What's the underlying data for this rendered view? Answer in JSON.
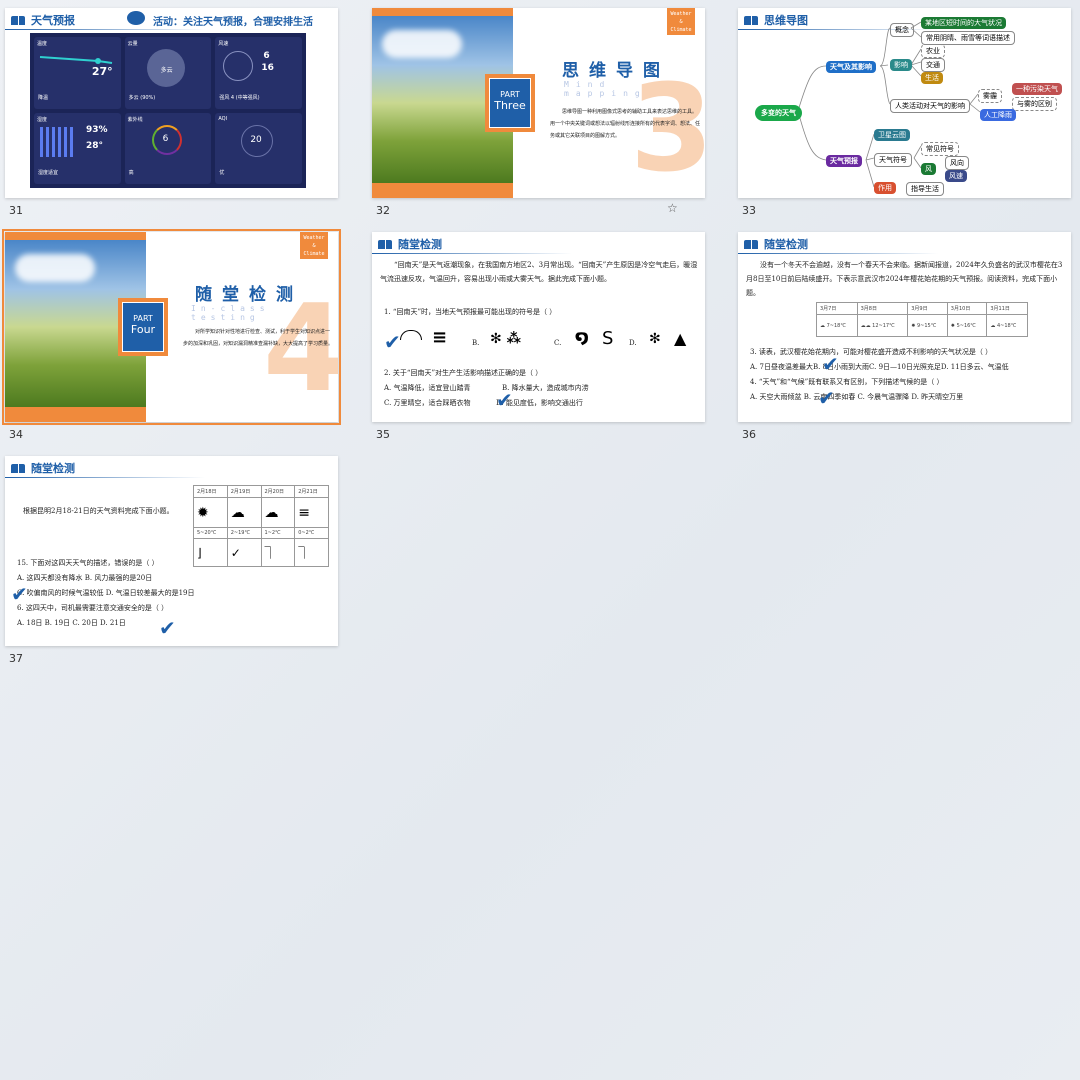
{
  "slides": [
    {
      "number": "31",
      "header": "天气预报",
      "activity": "活动：关注天气预报，合理安排生活",
      "dashboard": {
        "temp": "27°",
        "humidity": "93%",
        "feels": "28°",
        "uv": "6",
        "aqi": "20",
        "wind_level": "6",
        "wind_speed": "16",
        "cloud": "多云",
        "labels": [
          "温度",
          "云量",
          "风速",
          "湿度",
          "紫外线",
          "AQI"
        ],
        "status": [
          "降温",
          "多云 (90%)",
          "强风 4 (中等强风)",
          "湿度适宜",
          "高",
          "优"
        ]
      }
    },
    {
      "number": "32",
      "part": "PART",
      "part_name": "Three",
      "badge": [
        "Weather",
        "&",
        "Climate"
      ],
      "title": "思维导图",
      "subtitle": "Mind mapping",
      "big_number": "3",
      "body": "思维导图一种利用图像式思考的辅助工具来表达思维的工具。用一个中央关键词或想法以辐射线形连接所有的代表字词、想法、任务或其它关联项目的图解方式。"
    },
    {
      "number": "33",
      "header": "思维导图",
      "mindmap": {
        "root": "多变的天气",
        "b1": "天气及其影响",
        "b2": "天气预报",
        "concept": "概念",
        "c1": "某地区短时间的大气状况",
        "c2": "常用阴晴、雨雪等词语描述",
        "impact": "影响",
        "i1": "农业",
        "i2": "交通",
        "i3": "生活",
        "human": "人类活动对天气的影响",
        "haze": "雾霾",
        "h1": "一种污染天气",
        "h2": "与雾的区别",
        "rain": "人工降雨",
        "sat": "卫星云图",
        "symbols": "天气符号",
        "common": "常见符号",
        "wind": "风",
        "w1": "风向",
        "w2": "风速",
        "use": "作用",
        "u1": "指导生活"
      }
    },
    {
      "number": "34",
      "part": "PART",
      "part_name": "Four",
      "badge": [
        "Weather",
        "&",
        "Climate"
      ],
      "title": "随堂检测",
      "subtitle": "In-class testing",
      "big_number": "4",
      "body": "对所学知识针对性地进行检查、测试，利于学生对知识点进一步的加深和巩固，对知识漏洞精准查漏补缺，大大提高了学习质量。"
    },
    {
      "number": "35",
      "header": "随堂检测",
      "intro": "“回南天”是天气返潮现象，在我国南方地区2、3月常出现。“回南天”产生原因是冷空气走后，暖湿气流迅速反攻，气温回升，容易出现小雨或大雾天气。据此完成下面小题。",
      "q1": "1. “回南天”时，当地天气预报最可能出现的符号是（ ）",
      "opts1": [
        "A.",
        "B.",
        "C.",
        "D."
      ],
      "q2": "2. 关于“回南天”对生产生活影响描述正确的是（ ）",
      "q2a": "A. 气温降低，适宜登山踏青",
      "q2b": "B. 降水量大，造成城市内涝",
      "q2c": "C. 万里晴空，适合踩晒衣物",
      "q2d": "D. 能见度低，影响交通出行"
    },
    {
      "number": "36",
      "header": "随堂检测",
      "intro": "没有一个冬天不会逾越，没有一个春天不会来临。据新闻报道，2024年久负盛名的武汉市樱花在3月8日至10日前后陆续盛开。下表示意武汉市2024年樱花始花期的天气预报。阅读资料，完成下面小题。",
      "table": {
        "dates": [
          "3月7日",
          "3月8日",
          "3月9日",
          "3月10日",
          "3月11日"
        ],
        "temps": [
          "7~18℃",
          "12~17℃",
          "9~15℃",
          "5~16℃",
          "4~18℃"
        ]
      },
      "q3": "3. 读表，武汉樱花始花期内，可能对樱花盛开造成不利影响的天气状况是（ ）",
      "q3opts": "A. 7日昼夜温差最大B. 8日小雨到大雨C. 9日—10日光照充足D. 11日多云、气温低",
      "q4": "4. “天气”和“气候”既有联系又有区别，下列描述气候的是（ ）",
      "q4opts": "A. 天空大雨倾盆 B. 云南四季如春   C. 今晨气温骤降   D. 昨天晴空万里"
    },
    {
      "number": "37",
      "header": "随堂检测",
      "intro": "根据昆明2月18-21日的天气资料完成下面小题。",
      "table": {
        "dates": [
          "2月18日",
          "2月19日",
          "2月20日",
          "2月21日"
        ],
        "temps": [
          "5~20℃",
          "2~19℃",
          "1~2℃",
          "0~2℃"
        ]
      },
      "q15": "15. 下面对这四天天气的描述，错误的是（ ）",
      "q15ab": "A. 这四天都没有降水    B. 风力最强的是20日",
      "q15cd": "C. 吹偏南风的时候气温较低    D. 气温日较差最大的是19日",
      "q16": "6. 这四天中，司机最需要注意交通安全的是（ ）",
      "q16opts": "A. 18日    B. 19日     C. 20日      D. 21日"
    }
  ],
  "colors": {
    "accent": "#1f5fa8",
    "orange": "#f08a3c",
    "selection": "#f08a3c"
  }
}
